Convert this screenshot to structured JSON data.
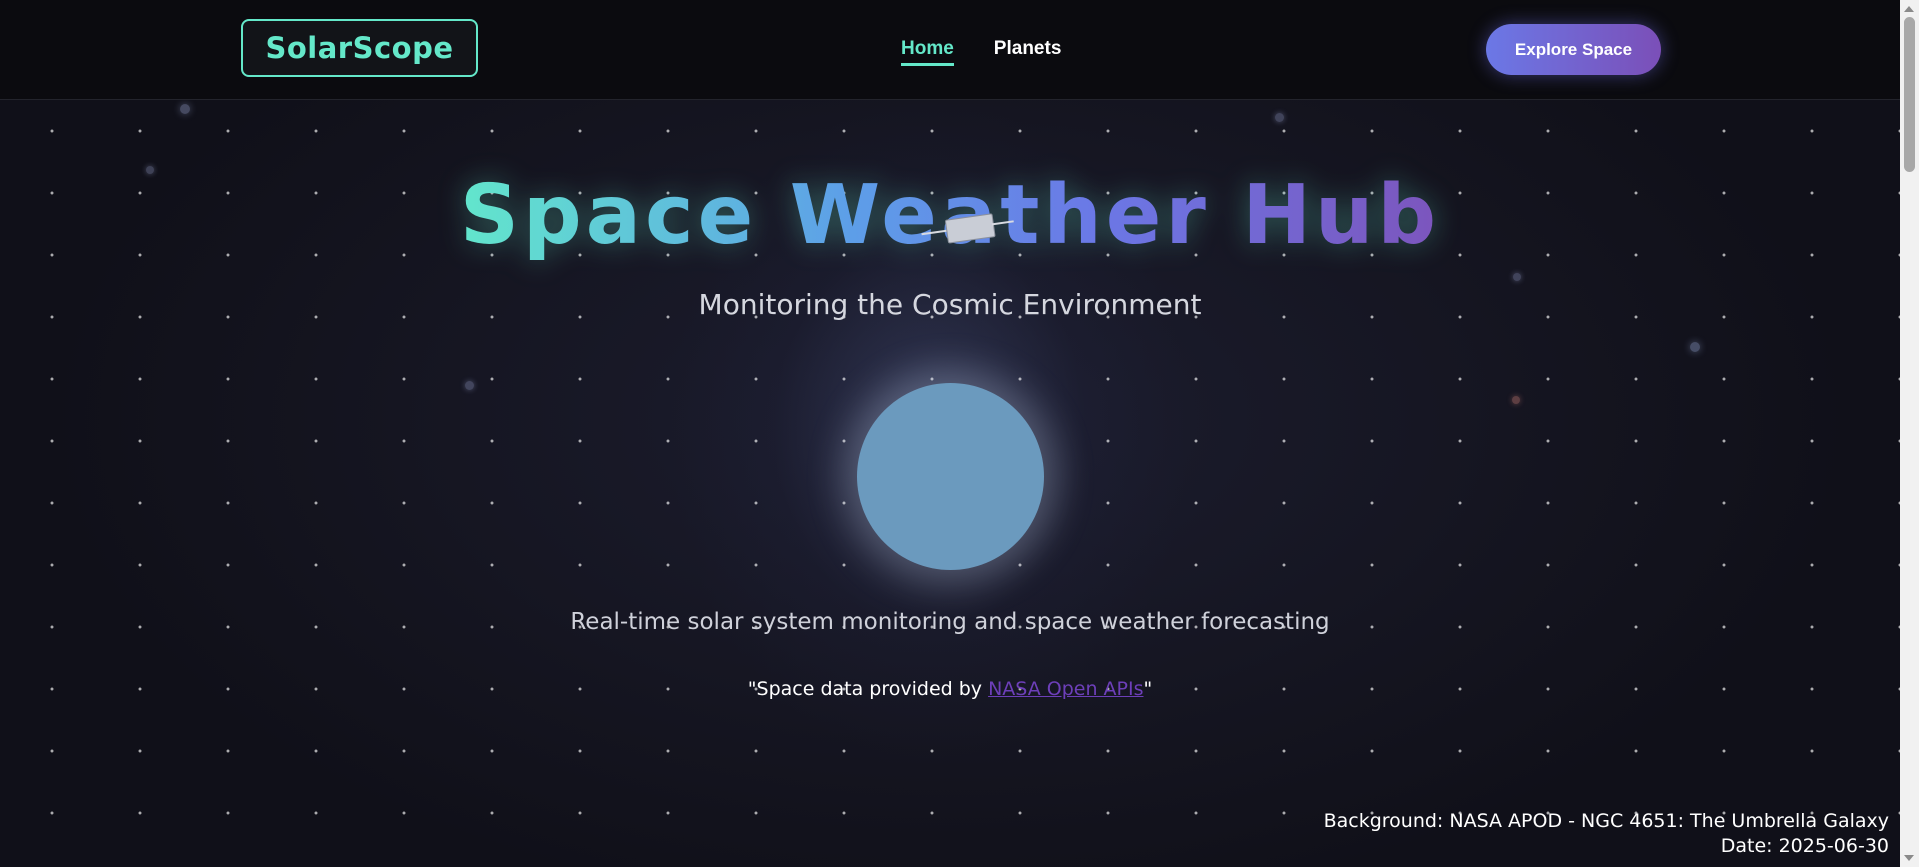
{
  "header": {
    "logo": "SolarScope",
    "nav": [
      {
        "label": "Home",
        "active": true
      },
      {
        "label": "Planets",
        "active": false
      }
    ],
    "cta_label": "Explore Space"
  },
  "hero": {
    "title": "Space Weather Hub",
    "subtitle": "Monitoring the Cosmic Environment",
    "tagline": "Real-time solar system monitoring and space weather forecasting",
    "credit_prefix": "\"Space data provided by ",
    "credit_link": "NASA Open APIs",
    "credit_suffix": "\""
  },
  "background_info": {
    "line1": "Background: NASA APOD - NGC 4651: The Umbrella Galaxy",
    "line2": "Date: 2025-06-30"
  },
  "colors": {
    "accent": "#64e8c9",
    "cta_start": "#6b78e6",
    "cta_end": "#7b4fb8",
    "link": "#6d3fb9",
    "planet": "#6b9abe",
    "header_bg": "#0b0b0f"
  }
}
